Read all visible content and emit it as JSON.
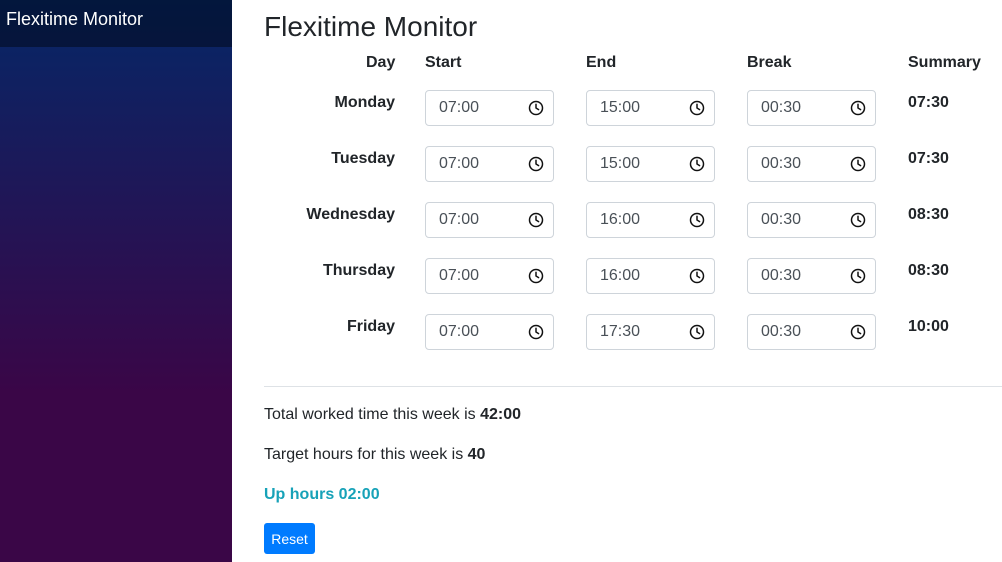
{
  "sidebar": {
    "brand": "Flexitime Monitor"
  },
  "page": {
    "title": "Flexitime Monitor"
  },
  "table": {
    "headers": {
      "day": "Day",
      "start": "Start",
      "end": "End",
      "break": "Break",
      "summary": "Summary"
    },
    "rows": [
      {
        "day": "Monday",
        "start": "07:00",
        "end": "15:00",
        "break": "00:30",
        "summary": "07:30"
      },
      {
        "day": "Tuesday",
        "start": "07:00",
        "end": "15:00",
        "break": "00:30",
        "summary": "07:30"
      },
      {
        "day": "Wednesday",
        "start": "07:00",
        "end": "16:00",
        "break": "00:30",
        "summary": "08:30"
      },
      {
        "day": "Thursday",
        "start": "07:00",
        "end": "16:00",
        "break": "00:30",
        "summary": "08:30"
      },
      {
        "day": "Friday",
        "start": "07:00",
        "end": "17:30",
        "break": "00:30",
        "summary": "10:00"
      }
    ]
  },
  "totals": {
    "worked_label": "Total worked time this week is",
    "worked_value": "42:00",
    "target_label": "Target hours for this week is",
    "target_value": "40",
    "up_hours": "Up hours 02:00"
  },
  "actions": {
    "reset_label": "Reset"
  },
  "icons": {
    "time_input": "clock-icon"
  },
  "colors": {
    "sidebar_top": "#052767",
    "sidebar_bottom": "#3a0647",
    "accent_button": "#007bff",
    "up_hours": "#17a2b8"
  }
}
